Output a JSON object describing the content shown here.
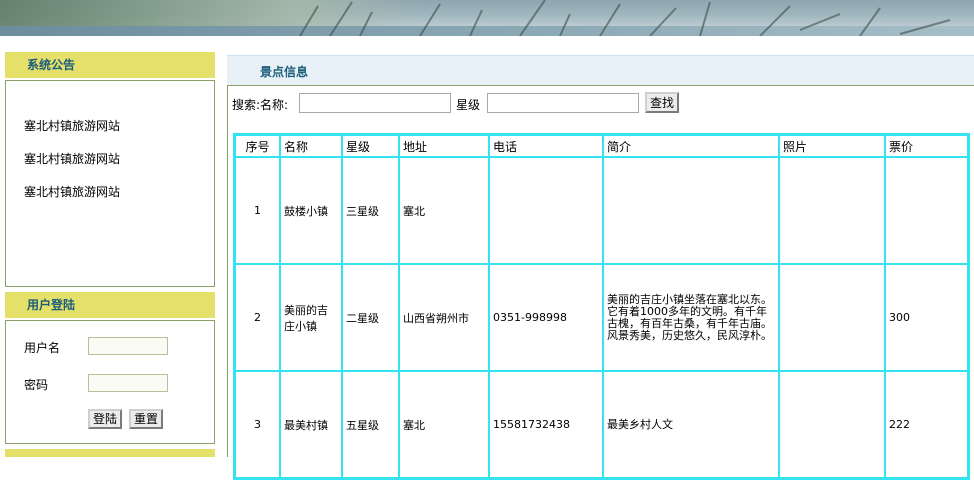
{
  "sidebar": {
    "notice": {
      "title": "系统公告",
      "items": [
        "塞北村镇旅游网站",
        "塞北村镇旅游网站",
        "塞北村镇旅游网站"
      ]
    },
    "login": {
      "title": "用户登陆",
      "username_label": "用户名",
      "password_label": "密码",
      "login_button": "登陆",
      "reset_button": "重置"
    }
  },
  "main": {
    "title": "景点信息",
    "search": {
      "label": "搜索:名称:",
      "star_label": "星级",
      "button": "查找"
    },
    "table": {
      "headers": [
        "序号",
        "名称",
        "星级",
        "地址",
        "电话",
        "简介",
        "照片",
        "票价"
      ],
      "rows": [
        {
          "no": "1",
          "name": "鼓楼小镇",
          "star": "三星级",
          "address": "塞北",
          "phone": "",
          "intro": "",
          "photo": "",
          "price": ""
        },
        {
          "no": "2",
          "name": "美丽的吉庄小镇",
          "star": "二星级",
          "address": "山西省朔州市",
          "phone": "0351-998998",
          "intro": "美丽的吉庄小镇坐落在塞北以东。它有着1000多年的文明。有千年古槐，有百年古桑，有千年古庙。风景秀美，历史悠久，民风淳朴。",
          "photo": "",
          "price": "300"
        },
        {
          "no": "3",
          "name": "最美村镇",
          "star": "五星级",
          "address": "塞北",
          "phone": "15581732438",
          "intro": "最美乡村人文",
          "photo": "",
          "price": "222"
        }
      ]
    }
  }
}
